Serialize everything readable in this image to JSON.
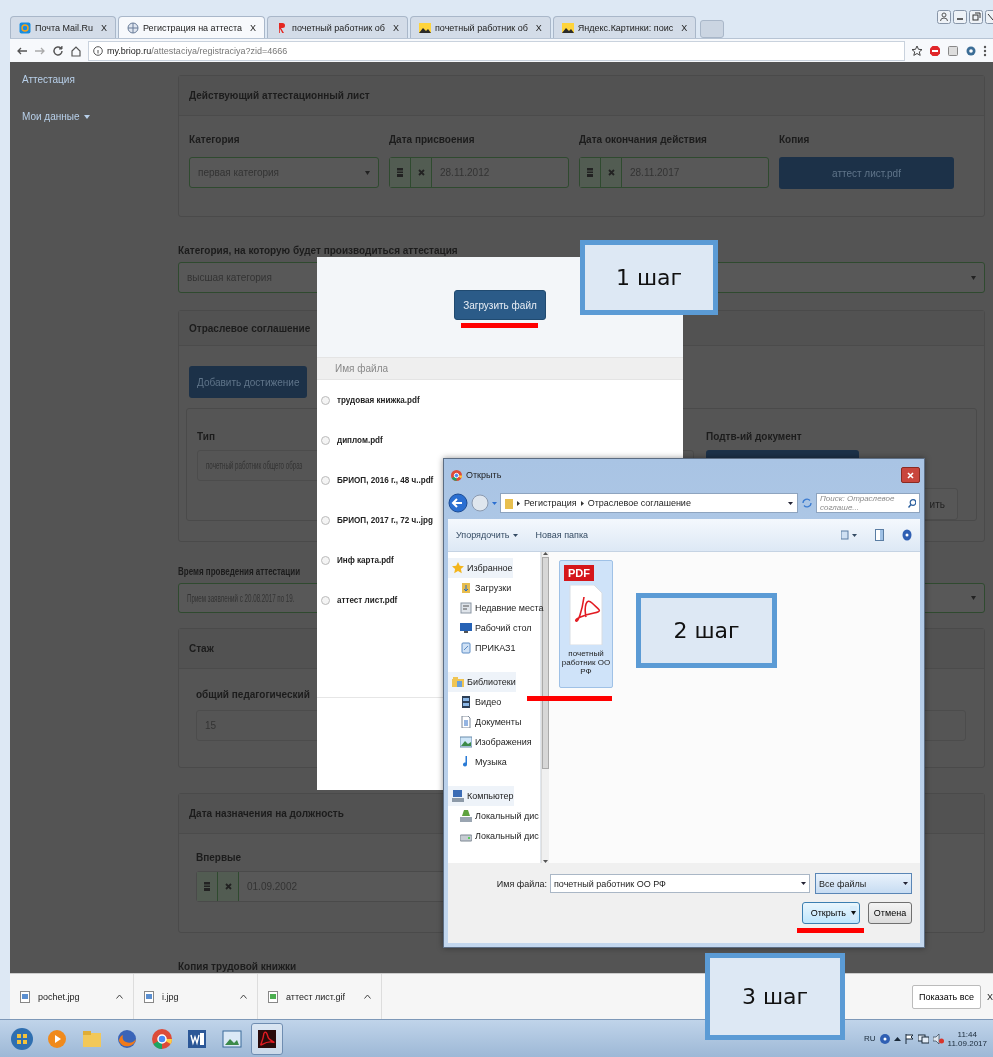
{
  "browser": {
    "tabs": [
      {
        "title": "Почта Mail.Ru",
        "kind": "mail",
        "selected": false,
        "close": "X"
      },
      {
        "title": "Регистрация на аттеста",
        "kind": "globe",
        "selected": true,
        "close": "X"
      },
      {
        "title": "почетный работник об",
        "kind": "yandex",
        "selected": false,
        "close": "X"
      },
      {
        "title": "почетный работник об",
        "kind": "image",
        "selected": false,
        "close": "X"
      },
      {
        "title": "Яндекс.Картинки: поис",
        "kind": "image",
        "selected": false,
        "close": "X"
      }
    ],
    "url_host": "my.briop.ru",
    "url_path": "/attestaciya/registraciya?zid=4666"
  },
  "sidebar": [
    {
      "label": "Аттестация",
      "has_menu": false
    },
    {
      "label": "Мои данные",
      "has_menu": true
    }
  ],
  "page": {
    "current_sheet": {
      "title": "Действующий аттестационный лист",
      "fields": [
        {
          "kind": "select",
          "label": "Категория",
          "value": "первая категория"
        },
        {
          "kind": "date",
          "label": "Дата присвоения",
          "value": "28.11.2012"
        },
        {
          "kind": "date",
          "label": "Дата окончания действия",
          "value": "28.11.2017"
        },
        {
          "kind": "button",
          "label": "Копия",
          "value": "аттест лист.pdf"
        }
      ]
    },
    "target_category": {
      "label": "Категория, на которую будет производиться аттестация",
      "value": "высшая категория"
    },
    "agreement": {
      "title": "Отраслевое соглашение",
      "add_button": "Добавить достижение",
      "type_label": "Тип",
      "type_value": "почетный работник общего образ",
      "document_label": "Подтв-ий документ",
      "remove_button": "ить"
    },
    "period": {
      "label": "Время проведения аттестации",
      "value": "Прием заявлений с 20.08.2017 по 19."
    },
    "experience": {
      "title": "Стаж",
      "label": "общий педагогический",
      "value": "15"
    },
    "appointment": {
      "title": "Дата назначения на должность",
      "label": "Впервые",
      "value": "01.09.2002"
    },
    "work_book": {
      "title": "Копия трудовой книжки"
    }
  },
  "upload_modal": {
    "button": "Загрузить файл",
    "column": "Имя файла",
    "files": [
      {
        "name": "трудовая книжка.pdf",
        "selected": false
      },
      {
        "name": "диплом.pdf",
        "selected": false
      },
      {
        "name": "БРИОП, 2016 г., 48 ч..pdf",
        "selected": false
      },
      {
        "name": "БРИОП, 2017 г., 72 ч..jpg",
        "selected": false
      },
      {
        "name": "Инф карта.pdf",
        "selected": false
      },
      {
        "name": "аттест лист.pdf",
        "selected": false
      }
    ]
  },
  "open_dialog": {
    "title": "Открыть",
    "path": [
      "Регистрация",
      "Отраслевое соглашение"
    ],
    "search_placeholder": "Поиск: Отраслевое соглаше...",
    "organize": "Упорядочить",
    "new_folder": "Новая папка",
    "nav": [
      {
        "label": "Избранное",
        "kind": "favorites",
        "children": [
          {
            "label": "Загрузки",
            "kind": "downloads"
          },
          {
            "label": "Недавние места",
            "kind": "recent"
          },
          {
            "label": "Рабочий стол",
            "kind": "desktop"
          },
          {
            "label": "ПРИКАЗ1",
            "kind": "shortcut"
          }
        ]
      },
      {
        "label": "Библиотеки",
        "kind": "libraries",
        "children": [
          {
            "label": "Видео",
            "kind": "video"
          },
          {
            "label": "Документы",
            "kind": "documents"
          },
          {
            "label": "Изображения",
            "kind": "pictures"
          },
          {
            "label": "Музыка",
            "kind": "music"
          }
        ]
      },
      {
        "label": "Компьютер",
        "kind": "computer",
        "children": [
          {
            "label": "Локальный дис",
            "kind": "system-disk"
          },
          {
            "label": "Локальный дис",
            "kind": "disk"
          }
        ]
      }
    ],
    "files": [
      {
        "name": "почетный работник ОО РФ",
        "kind": "pdf",
        "badge": "PDF",
        "selected": true
      }
    ],
    "filename_label": "Имя файла:",
    "filename": "почетный работник ОО РФ",
    "filter": "Все файлы",
    "open_button": "Открыть",
    "cancel_button": "Отмена"
  },
  "callouts": [
    {
      "text": "1 шаг"
    },
    {
      "text": "2 шаг"
    },
    {
      "text": "3 шаг"
    }
  ],
  "downloads": {
    "items": [
      {
        "name": "pochet.jpg",
        "kind": "image"
      },
      {
        "name": "i.jpg",
        "kind": "image"
      },
      {
        "name": "аттест лист.gif",
        "kind": "gif"
      }
    ],
    "show_all": "Показать все",
    "close": "X"
  },
  "taskbar": {
    "apps": [
      {
        "kind": "start",
        "active": false
      },
      {
        "kind": "media",
        "active": false
      },
      {
        "kind": "explorer",
        "active": false
      },
      {
        "kind": "firefox",
        "active": false
      },
      {
        "kind": "chrome",
        "active": false
      },
      {
        "kind": "word",
        "active": false
      },
      {
        "kind": "viewer",
        "active": false
      },
      {
        "kind": "acrobat",
        "active": true
      }
    ],
    "lang": "RU",
    "time": "11:44",
    "date": "11.09.2017"
  }
}
